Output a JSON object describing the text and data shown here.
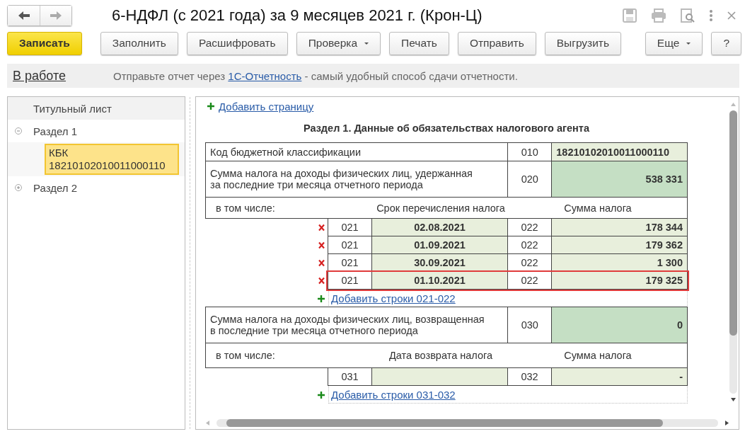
{
  "window": {
    "title": "6-НДФЛ (с 2021 года) за 9 месяцев 2021 г. (Крон-Ц)"
  },
  "toolbar": {
    "buttons": [
      {
        "label": "Записать",
        "kind": "primary"
      },
      {
        "label": "Заполнить",
        "kind": "plain"
      },
      {
        "label": "Расшифровать",
        "kind": "plain"
      },
      {
        "label": "Проверка",
        "kind": "dropdown"
      },
      {
        "label": "Печать",
        "kind": "plain"
      },
      {
        "label": "Отправить",
        "kind": "plain"
      },
      {
        "label": "Выгрузить",
        "kind": "plain"
      }
    ],
    "right_buttons": [
      {
        "label": "Еще",
        "kind": "dropdown"
      },
      {
        "label": "?",
        "kind": "plain"
      }
    ]
  },
  "info_bar": {
    "status": "В работе",
    "message_before": "Отправьте отчет через ",
    "link": "1С-Отчетность",
    "message_after": " - самый удобный способ сдачи отчетности."
  },
  "sidebar": {
    "items": [
      {
        "label": "Титульный лист",
        "selected": false
      },
      {
        "label": "Раздел 1",
        "selected": false,
        "expanded": true,
        "children": [
          {
            "label": "КБК 18210102010011000110",
            "selected": true
          }
        ]
      },
      {
        "label": "Раздел 2",
        "selected": false,
        "expanded": false
      }
    ]
  },
  "form": {
    "add_page_link": "Добавить страницу",
    "section_title": "Раздел 1. Данные об обязательствах налогового агента",
    "rows": [
      {
        "kind": "text_field",
        "label": "Код бюджетной классификации",
        "code": "010",
        "value": "18210102010011000110"
      },
      {
        "kind": "sum_field",
        "label": "Сумма налога на доходы физических лиц, удержанная\nза последние три месяца отчетного периода",
        "code": "020",
        "value": "538 331"
      },
      {
        "kind": "header",
        "cells": [
          "в том числе:",
          "Срок перечисления налога",
          "Сумма налога"
        ]
      },
      {
        "kind": "payment",
        "code1": "021",
        "date": "02.08.2021",
        "code2": "022",
        "amount": "178 344",
        "highlighted": false
      },
      {
        "kind": "payment",
        "code1": "021",
        "date": "01.09.2021",
        "code2": "022",
        "amount": "179 362",
        "highlighted": false
      },
      {
        "kind": "payment",
        "code1": "021",
        "date": "30.09.2021",
        "code2": "022",
        "amount": "1 300",
        "highlighted": false
      },
      {
        "kind": "payment",
        "code1": "021",
        "date": "01.10.2021",
        "code2": "022",
        "amount": "179 325",
        "highlighted": true
      },
      {
        "kind": "add",
        "link": "Добавить строки 021-022"
      },
      {
        "kind": "sum_field",
        "label": "Сумма налога на доходы физических лиц, возвращенная\nв последние три месяца отчетного периода",
        "code": "030",
        "value": "0"
      },
      {
        "kind": "header",
        "cells": [
          "в том числе:",
          "Дата возврата налога",
          "Сумма налога"
        ]
      },
      {
        "kind": "refund",
        "code1": "031",
        "code2": "032",
        "amount": "-"
      },
      {
        "kind": "add",
        "link": "Добавить строки 031-032"
      }
    ]
  }
}
